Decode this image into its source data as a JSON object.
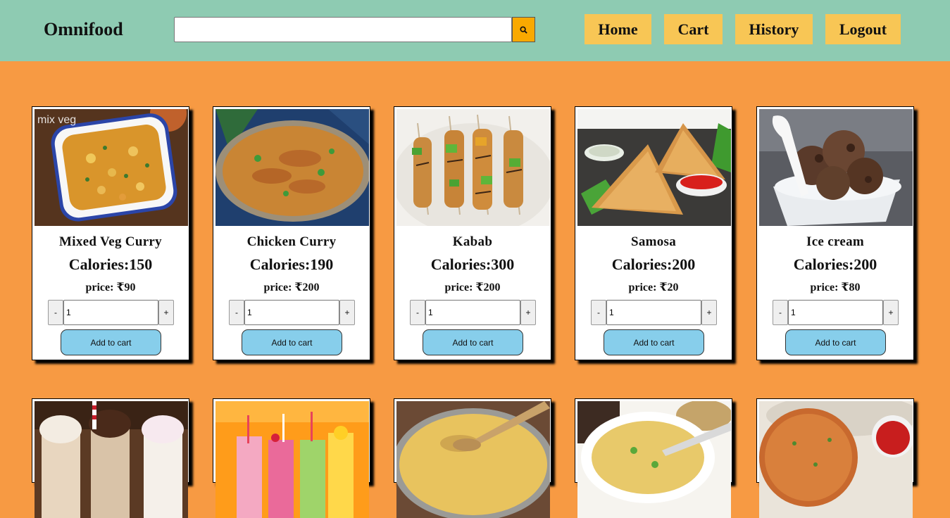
{
  "header": {
    "logo": "Omnifood",
    "search": {
      "value": "",
      "placeholder": "",
      "icon": "search-icon"
    },
    "nav": [
      "Home",
      "Cart",
      "History",
      "Logout"
    ]
  },
  "colors": {
    "header_bg": "#8ecbb2",
    "page_bg": "#f79a43",
    "nav_button": "#f8c655",
    "search_button": "#f9a900",
    "add_to_cart": "#87ceeb"
  },
  "products": [
    {
      "name": "Mixed Veg Curry",
      "calories": "Calories:150",
      "price": "price: ₹90",
      "quantity": "1",
      "minus": "-",
      "plus": "+",
      "add_label": "Add to cart",
      "image_caption": "mix veg"
    },
    {
      "name": "Chicken Curry",
      "calories": "Calories:190",
      "price": "price: ₹200",
      "quantity": "1",
      "minus": "-",
      "plus": "+",
      "add_label": "Add to cart"
    },
    {
      "name": "Kabab",
      "calories": "Calories:300",
      "price": "price: ₹200",
      "quantity": "1",
      "minus": "-",
      "plus": "+",
      "add_label": "Add to cart"
    },
    {
      "name": "Samosa",
      "calories": "Calories:200",
      "price": "price: ₹20",
      "quantity": "1",
      "minus": "-",
      "plus": "+",
      "add_label": "Add to cart"
    },
    {
      "name": "Ice cream",
      "calories": "Calories:200",
      "price": "price: ₹80",
      "quantity": "1",
      "minus": "-",
      "plus": "+",
      "add_label": "Add to cart"
    }
  ],
  "products_row2": [
    {
      "image": "milkshakes-image"
    },
    {
      "image": "juices-image"
    },
    {
      "image": "soup-image"
    },
    {
      "image": "noodle-soup-image"
    },
    {
      "image": "cutlet-image"
    }
  ]
}
